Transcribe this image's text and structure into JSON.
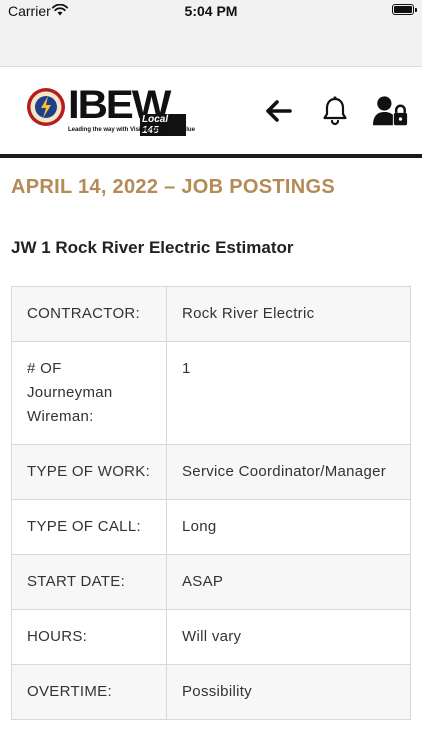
{
  "status_bar": {
    "carrier": "Carrier",
    "time": "5:04 PM",
    "wifi_icon": "wifi-icon",
    "battery_icon": "battery-icon"
  },
  "header": {
    "logo": {
      "wordmark": "IBEW",
      "local": "Local 145",
      "tagline": "Leading the way with Vision, Quality & Value",
      "seal_icon": "union-seal-icon"
    },
    "back_icon": "arrow-left-icon",
    "notifications_icon": "bell-icon",
    "account_icon": "user-lock-icon"
  },
  "page": {
    "posting_title": "APRIL 14, 2022 – JOB POSTINGS",
    "job_title": "JW 1 Rock River Electric Estimator",
    "details": [
      {
        "label": "CONTRACTOR:",
        "value": "Rock River Electric"
      },
      {
        "label": "# OF Journeyman Wireman:",
        "value": "1"
      },
      {
        "label": "TYPE OF WORK:",
        "value": "Service Coordinator/Manager"
      },
      {
        "label": "TYPE OF CALL:",
        "value": "Long"
      },
      {
        "label": "START DATE:",
        "value": "ASAP"
      },
      {
        "label": "HOURS:",
        "value": "Will vary"
      },
      {
        "label": "OVERTIME:",
        "value": "Possibility"
      }
    ]
  },
  "colors": {
    "accent": "#b48a55",
    "header_rule": "#1a1a1a",
    "status_bar_bg": "#f2f2f2",
    "row_alt_bg": "#f7f7f7",
    "border": "#d8d8d8"
  }
}
